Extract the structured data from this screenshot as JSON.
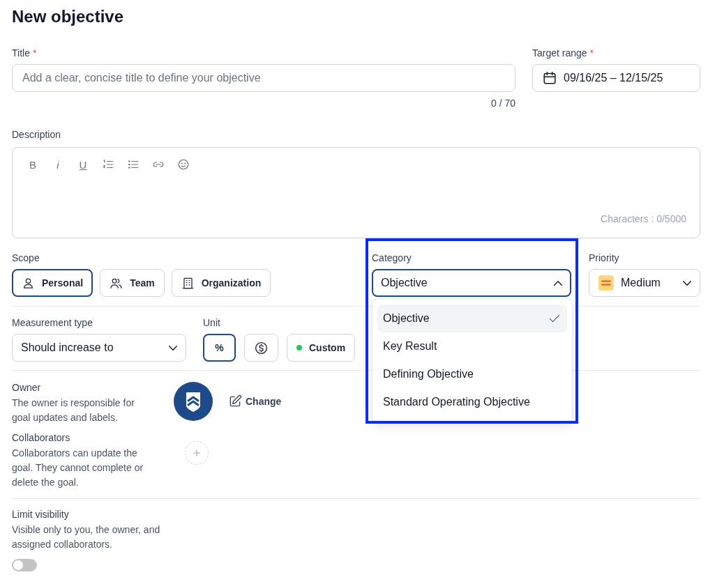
{
  "page": {
    "title": "New objective"
  },
  "title_field": {
    "label": "Title",
    "required_mark": "*",
    "placeholder": "Add a clear, concise title to define your objective",
    "counter": "0 / 70"
  },
  "target_range": {
    "label": "Target range",
    "required_mark": "*",
    "value": "09/16/25 – 12/15/25"
  },
  "description": {
    "label": "Description",
    "counter": "Characters : 0/5000",
    "toolbar": [
      {
        "kind": "bold",
        "label": "B"
      },
      {
        "kind": "italic",
        "label": "i"
      },
      {
        "kind": "underline",
        "label": "U"
      },
      {
        "kind": "numbered-list"
      },
      {
        "kind": "bulleted-list"
      },
      {
        "kind": "link"
      },
      {
        "kind": "emoji"
      }
    ]
  },
  "scope": {
    "label": "Scope",
    "options": [
      {
        "kind": "person",
        "label": "Personal",
        "selected": true
      },
      {
        "kind": "team",
        "label": "Team",
        "selected": false
      },
      {
        "kind": "building",
        "label": "Organization",
        "selected": false
      }
    ]
  },
  "category": {
    "label": "Category",
    "value": "Objective",
    "expanded": true,
    "highlighted": true,
    "options": [
      {
        "label": "Objective",
        "selected": true
      },
      {
        "label": "Key Result",
        "selected": false
      },
      {
        "label": "Defining Objective",
        "selected": false
      },
      {
        "label": "Standard Operating Objective",
        "selected": false
      }
    ]
  },
  "priority": {
    "label": "Priority",
    "value": "Medium"
  },
  "measurement_type": {
    "label": "Measurement type",
    "value": "Should increase to"
  },
  "unit": {
    "label": "Unit",
    "options": [
      {
        "kind": "percent",
        "label": "%",
        "selected": true
      },
      {
        "kind": "currency",
        "selected": false
      },
      {
        "kind": "custom",
        "label": "Custom",
        "selected": false
      }
    ]
  },
  "owner": {
    "label": "Owner",
    "description": "The owner is responsible for goal updates and labels.",
    "change_label": "Change"
  },
  "collaborators": {
    "label": "Collaborators",
    "description": "Collaborators can update the goal. They cannot complete or delete the goal."
  },
  "limit_visibility": {
    "label": "Limit visibility",
    "description": "Visible only to you, the owner, and assigned collaborators.",
    "on": false
  }
}
